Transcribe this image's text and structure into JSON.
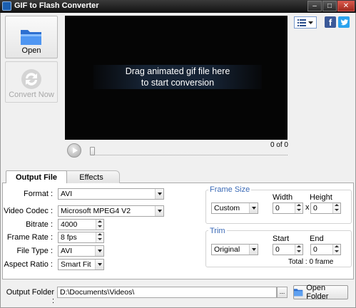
{
  "window": {
    "title": "GIF to Flash Converter",
    "minimize": "–",
    "maximize": "□",
    "close": "✕"
  },
  "toolbar": {
    "open_label": "Open",
    "convert_label": "Convert Now"
  },
  "preview": {
    "drop_line1": "Drag animated gif file here",
    "drop_line2": "to start conversion",
    "frame_counter": "0 of 0",
    "seek_fraction": 0
  },
  "social": {
    "facebook": "f"
  },
  "tabs": [
    {
      "label": "Output File",
      "active": true
    },
    {
      "label": "Effects",
      "active": false
    }
  ],
  "output": {
    "format_label": "Format :",
    "format_value": "AVI",
    "video_codec_label": "Video Codec :",
    "video_codec_value": "Microsoft MPEG4 V2",
    "bitrate_label": "Bitrate :",
    "bitrate_value": "4000",
    "frame_rate_label": "Frame Rate :",
    "frame_rate_value": "8 fps",
    "file_type_label": "File Type :",
    "file_type_value": "AVI",
    "aspect_ratio_label": "Aspect Ratio :",
    "aspect_ratio_value": "Smart Fit"
  },
  "frame_size": {
    "title": "Frame Size",
    "mode_value": "Custom",
    "width_label": "Width",
    "width_value": "0",
    "times": "x",
    "height_label": "Height",
    "height_value": "0"
  },
  "trim": {
    "title": "Trim",
    "mode_value": "Original",
    "start_label": "Start",
    "start_value": "0",
    "end_label": "End",
    "end_value": "0",
    "total": "Total : 0 frame"
  },
  "bottom": {
    "output_folder_label": "Output Folder :",
    "output_folder_value": "D:\\Documents\\Videos\\",
    "browse_label": "...",
    "open_folder_label": "Open Folder"
  },
  "colors": {
    "group_title": "#3b6ab6",
    "facebook": "#3b5998",
    "twitter": "#2ba3ee"
  }
}
